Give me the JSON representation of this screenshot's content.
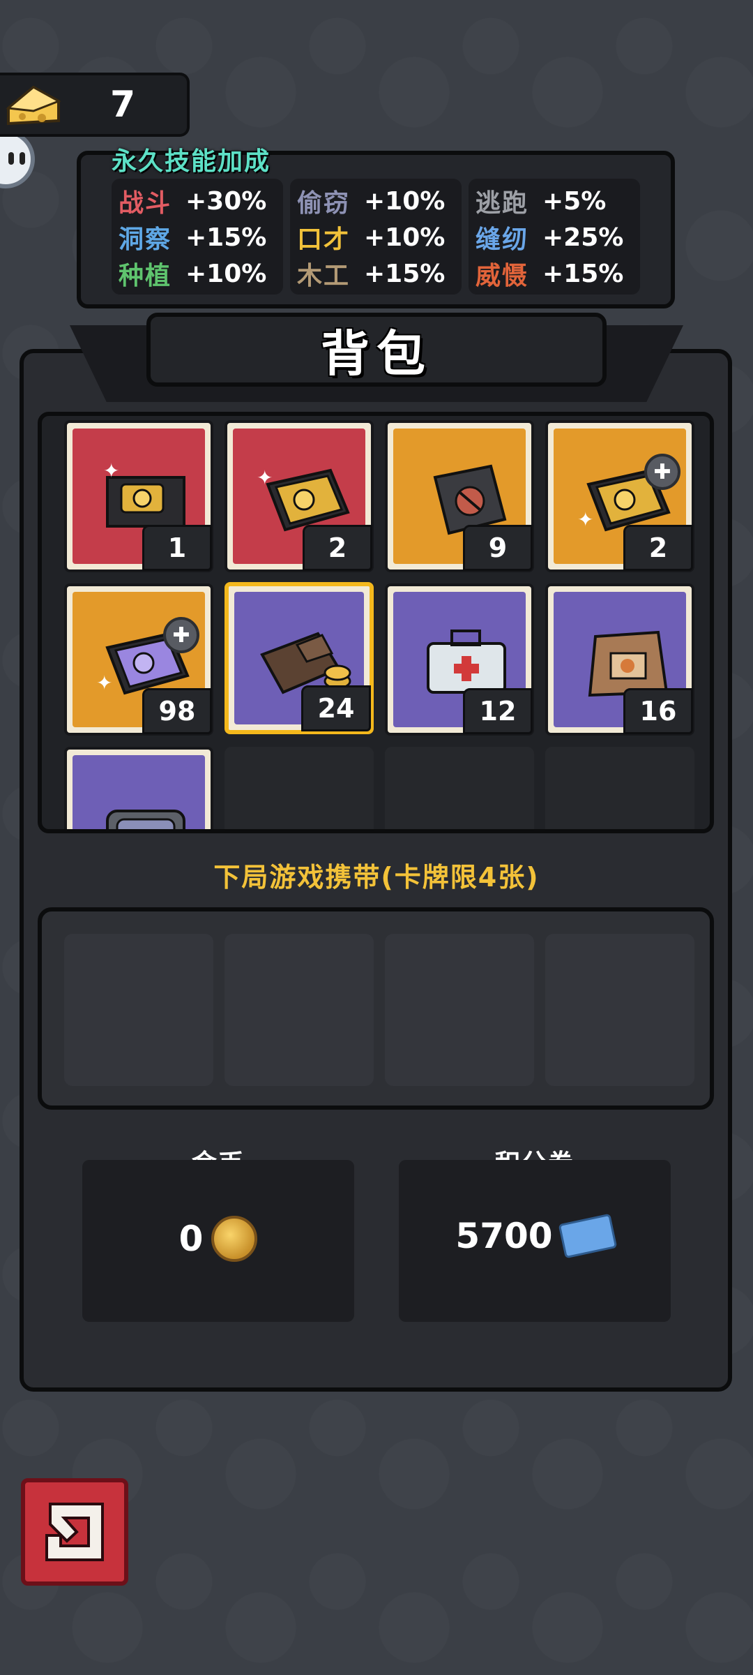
{
  "cheese": {
    "count": "7",
    "icon": "cheese-icon"
  },
  "skills": {
    "title": "永久技能加成",
    "columns": [
      [
        {
          "name": "战斗",
          "value": "+30%",
          "color": "#e25c63"
        },
        {
          "name": "洞察",
          "value": "+15%",
          "color": "#5fa8e6"
        },
        {
          "name": "种植",
          "value": "+10%",
          "color": "#5fc46e"
        }
      ],
      [
        {
          "name": "偷窃",
          "value": "+10%",
          "color": "#8e92b4"
        },
        {
          "name": "口才",
          "value": "+10%",
          "color": "#f2c23a"
        },
        {
          "name": "木工",
          "value": "+15%",
          "color": "#b39a75"
        }
      ],
      [
        {
          "name": "逃跑",
          "value": "+5%",
          "color": "#9da0a6"
        },
        {
          "name": "缝纫",
          "value": "+25%",
          "color": "#6aa6e8"
        },
        {
          "name": "威慑",
          "value": "+15%",
          "color": "#e2643a"
        }
      ]
    ]
  },
  "backpack": {
    "title": "背包",
    "items": [
      {
        "name": "golden-ticket-box-icon",
        "qty": "1",
        "bg": "red"
      },
      {
        "name": "gold-card-pack-icon",
        "qty": "2",
        "bg": "red"
      },
      {
        "name": "sealed-card-pack-icon",
        "qty": "9",
        "bg": "orange"
      },
      {
        "name": "card-pack-fragment-icon",
        "qty": "2",
        "bg": "orange",
        "fragment": true
      },
      {
        "name": "purple-card-fragment-icon",
        "qty": "98",
        "bg": "orange",
        "fragment": true
      },
      {
        "name": "wallet-icon",
        "qty": "24",
        "bg": "purple",
        "selected": true
      },
      {
        "name": "first-aid-kit-icon",
        "qty": "12",
        "bg": "purple"
      },
      {
        "name": "cheese-bag-icon",
        "qty": "16",
        "bg": "purple"
      },
      {
        "name": "brain-jar-icon",
        "qty": "",
        "bg": "purple"
      }
    ]
  },
  "carry": {
    "label": "下局游戏携带(卡牌限4张)"
  },
  "currency": {
    "gold": {
      "label": "金币",
      "value": "0",
      "icon": "gold-coin-icon"
    },
    "points": {
      "label": "积分券",
      "value": "5700",
      "icon": "points-ticket-icon"
    }
  },
  "exit_icon": "exit-arrow-icon"
}
